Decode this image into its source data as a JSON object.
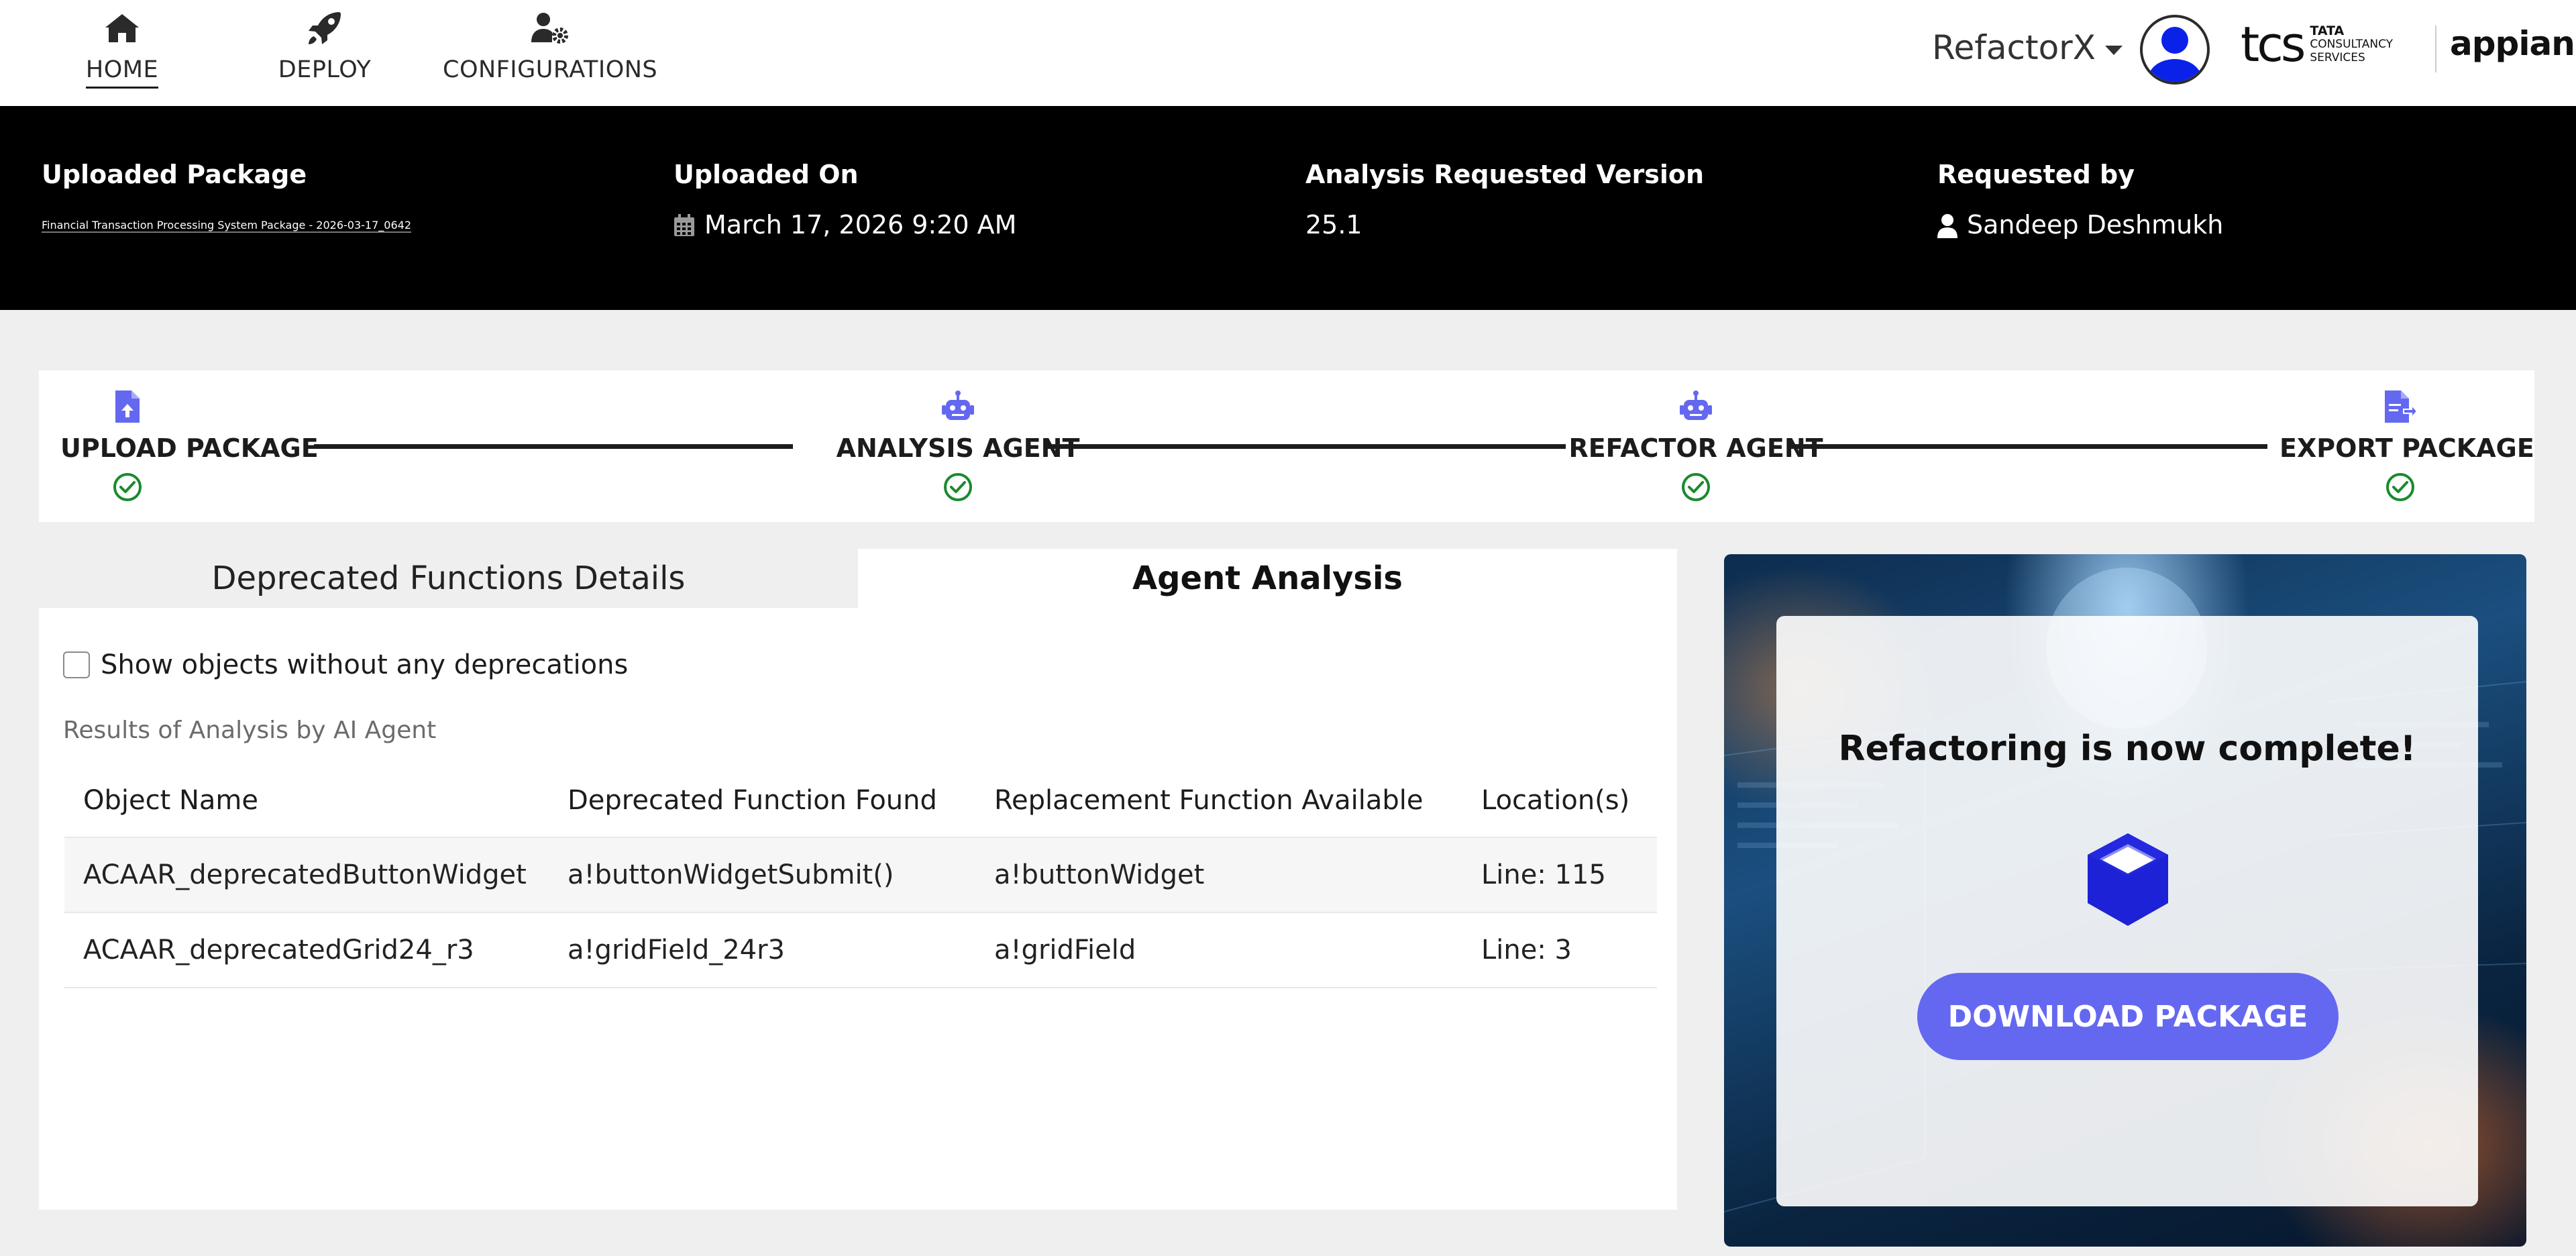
{
  "nav": {
    "items": [
      {
        "label": "HOME",
        "icon": "home-icon",
        "active": true
      },
      {
        "label": "DEPLOY",
        "icon": "rocket-icon",
        "active": false
      },
      {
        "label": "CONFIGURATIONS",
        "icon": "user-gear-icon",
        "active": false
      }
    ],
    "app_name": "RefactorX",
    "logos": {
      "tcs_wordmark": "tcs",
      "tcs_line1": "TATA",
      "tcs_line2": "CONSULTANCY",
      "tcs_line3": "SERVICES",
      "appian": "appian"
    }
  },
  "package": {
    "uploaded_package_label": "Uploaded Package",
    "uploaded_package_value": "Financial Transaction Processing System Package - 2026-03-17_0642",
    "uploaded_on_label": "Uploaded On",
    "uploaded_on_value": "March 17, 2026 9:20 AM",
    "version_label": "Analysis Requested Version",
    "version_value": "25.1",
    "requested_by_label": "Requested by",
    "requested_by_value": "Sandeep Deshmukh"
  },
  "stepper": {
    "steps": [
      {
        "label": "UPLOAD PACKAGE",
        "icon": "file-upload-icon",
        "status": "complete"
      },
      {
        "label": "ANALYSIS AGENT",
        "icon": "robot-icon",
        "status": "complete"
      },
      {
        "label": "REFACTOR AGENT",
        "icon": "robot-icon",
        "status": "complete"
      },
      {
        "label": "EXPORT PACKAGE",
        "icon": "file-export-icon",
        "status": "complete"
      }
    ],
    "accent_color": "#6468f0",
    "check_color": "#1a8a2e"
  },
  "tabs": {
    "details": "Deprecated Functions Details",
    "agent": "Agent Analysis",
    "selected": "agent"
  },
  "analysis": {
    "show_without_deprecations_label": "Show objects without any deprecations",
    "show_without_deprecations_checked": false,
    "caption": "Results of Analysis by AI Agent",
    "columns": [
      "Object Name",
      "Deprecated Function Found",
      "Replacement Function Available",
      "Location(s)"
    ],
    "rows": [
      [
        "ACAAR_deprecatedButtonWidget",
        "a!buttonWidgetSubmit()",
        "a!buttonWidget",
        "Line: 115"
      ],
      [
        "ACAAR_deprecatedGrid24_r3",
        "a!gridField_24r3",
        "a!gridField",
        "Line: 3"
      ]
    ]
  },
  "promo": {
    "title": "Refactoring is now complete!",
    "icon": "cube-icon",
    "button_label": "DOWNLOAD PACKAGE",
    "button_color": "#6468f0"
  }
}
